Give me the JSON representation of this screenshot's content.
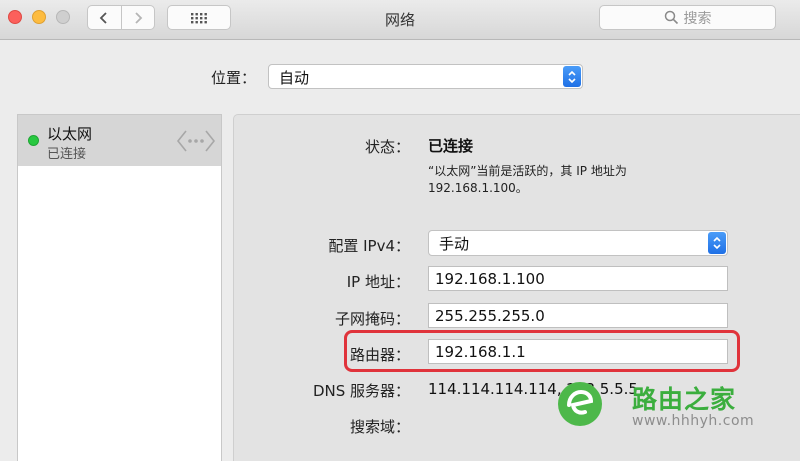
{
  "window": {
    "title": "网络"
  },
  "toolbar": {
    "search_placeholder": "搜索"
  },
  "location": {
    "label": "位置：",
    "value": "自动"
  },
  "sidebar": {
    "services": [
      {
        "name": "以太网",
        "status": "已连接",
        "status_color": "#28c840"
      }
    ]
  },
  "detail": {
    "status_label": "状态：",
    "status_value": "已连接",
    "status_desc_line1": "“以太网”当前是活跃的，其 IP 地址为",
    "status_desc_line2": "192.168.1.100。",
    "ipv4_config_label": "配置 IPv4：",
    "ipv4_config_value": "手动",
    "ip_label": "IP 地址：",
    "ip_value": "192.168.1.100",
    "subnet_label": "子网掩码：",
    "subnet_value": "255.255.255.0",
    "router_label": "路由器：",
    "router_value": "192.168.1.1",
    "dns_label": "DNS 服务器：",
    "dns_value": "114.114.114.114, 223.5.5.5",
    "search_domain_label": "搜索域："
  },
  "watermark": {
    "name": "路由之家",
    "url": "www.hhhyh.com"
  },
  "colors": {
    "highlight": "#e0333b",
    "accent": "#1f70e6",
    "connected": "#28c840"
  }
}
